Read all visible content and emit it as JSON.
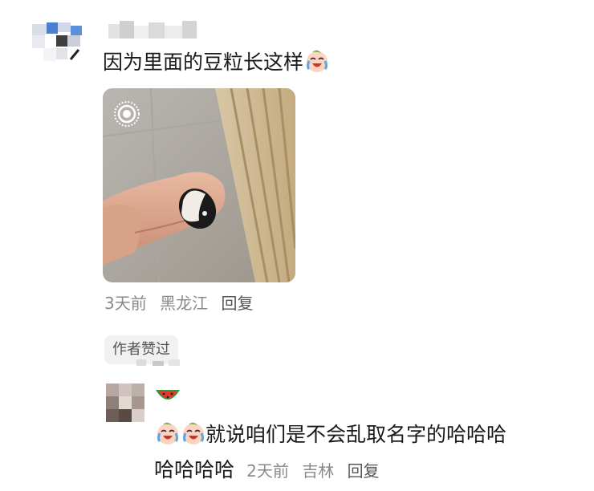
{
  "comment": {
    "text": "因为里面的豆粒长这样",
    "emoji": "crying-laughing-face",
    "time": "3天前",
    "location": "黑龙江",
    "reply_label": "回复",
    "author_liked_badge": "作者赞过"
  },
  "reply": {
    "name_emoji": "watermelon",
    "emojis": [
      "crying-laughing-face",
      "crying-laughing-face"
    ],
    "text_line1": "就说咱们是不会乱取名字的哈哈哈",
    "text_line2": "哈哈哈哈",
    "time": "2天前",
    "location": "吉林",
    "reply_label": "回复"
  }
}
